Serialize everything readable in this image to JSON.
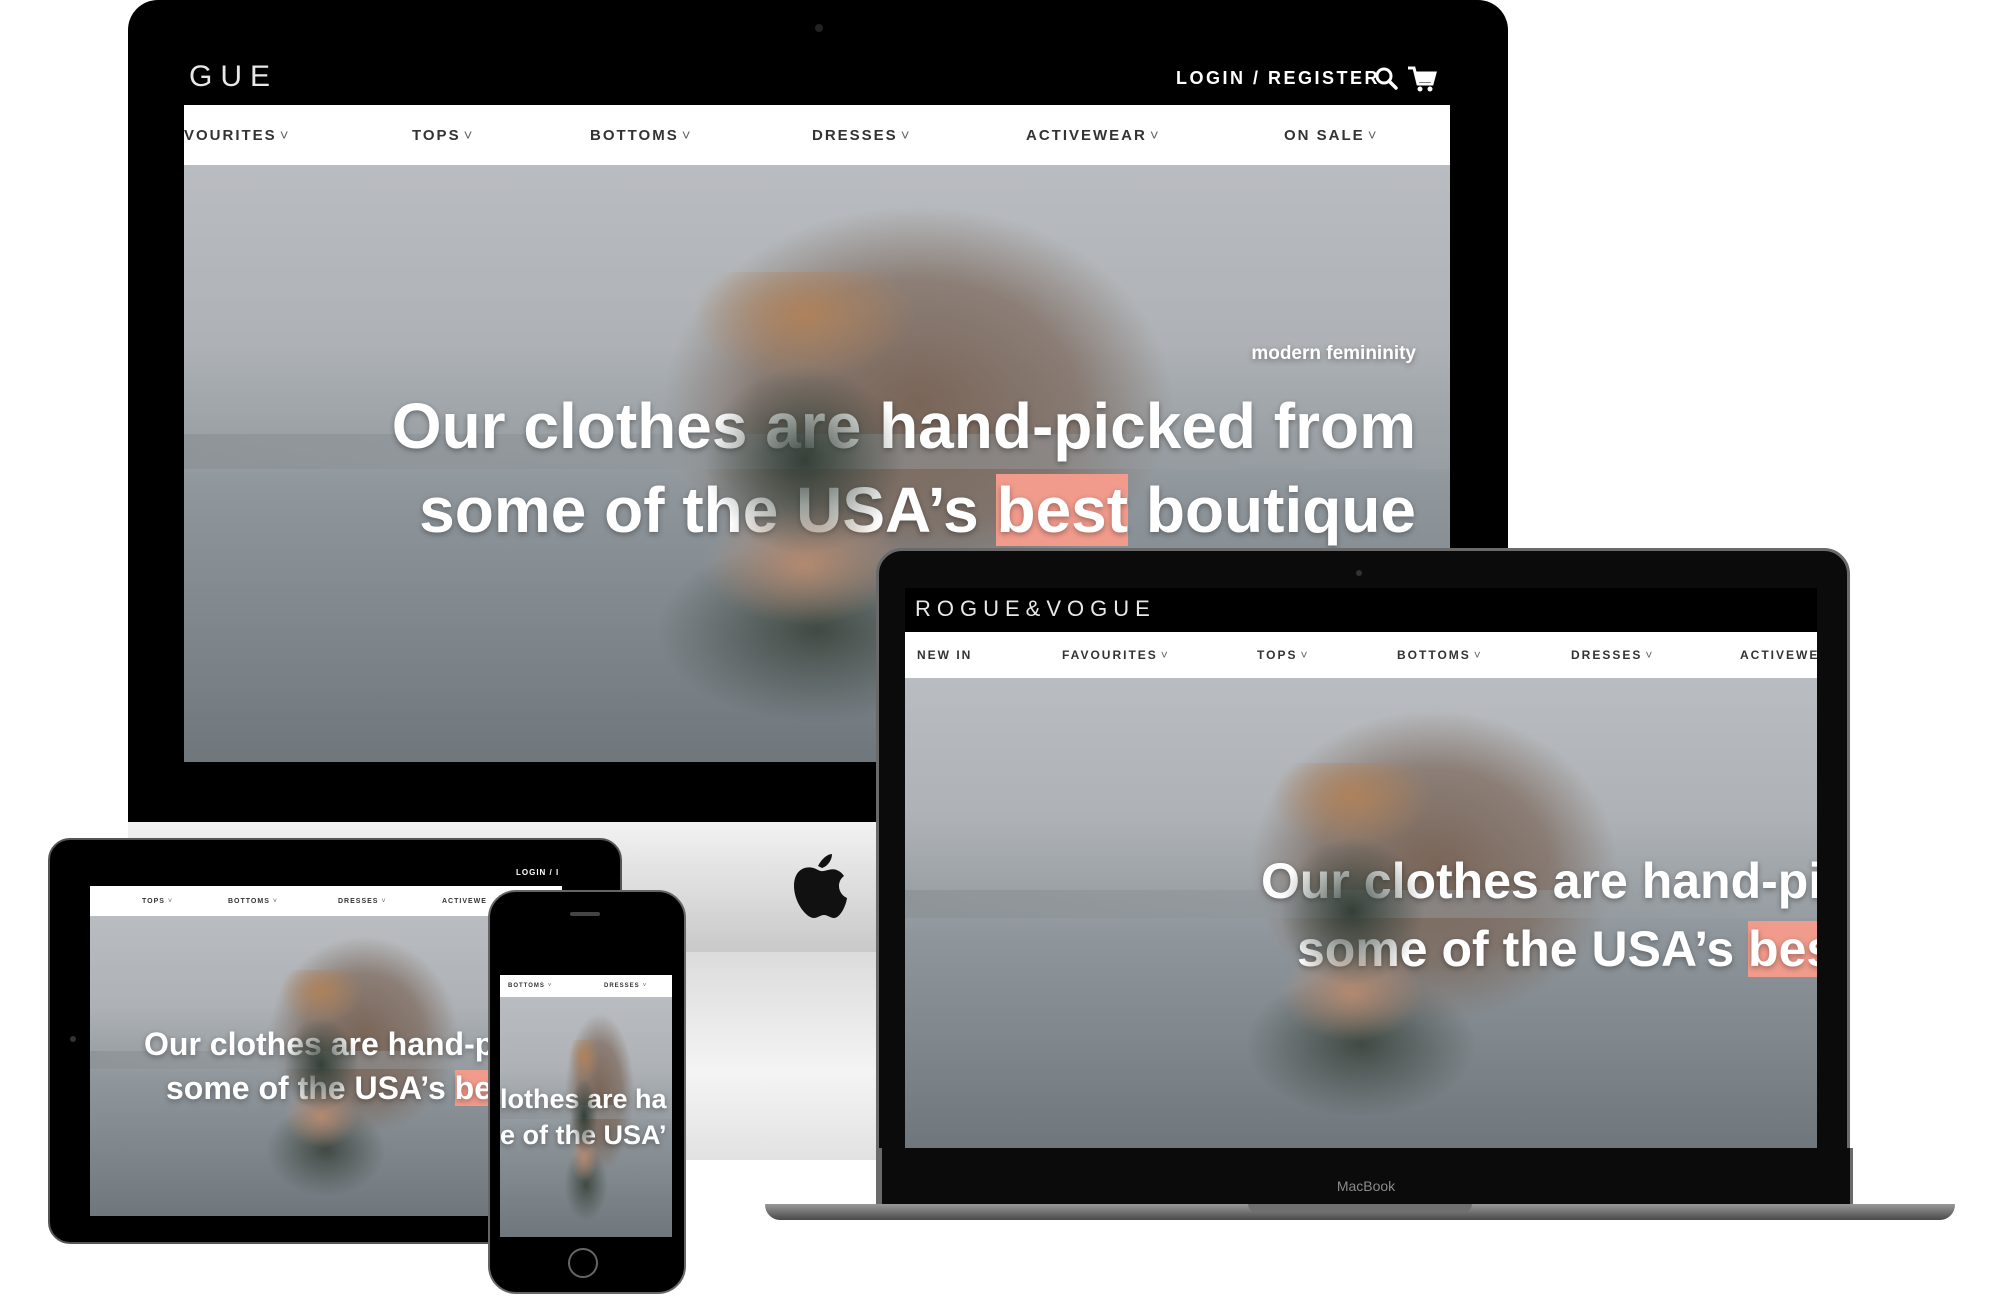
{
  "brand": {
    "full": "ROGUE&VOGUE",
    "truncated": "GUE"
  },
  "colors": {
    "accent": "#f19b8c",
    "frame": "#000000",
    "nav_bg": "#ffffff"
  },
  "desktop": {
    "login": "LOGIN / REGISTER",
    "nav": [
      "VOURITES",
      "TOPS",
      "BOTTOMS",
      "DRESSES",
      "ACTIVEWEAR",
      "ON SALE"
    ],
    "tagline": "modern femininity",
    "hero_line1": "Our clothes are hand-picked from",
    "hero_line2_pre": "some of the USA’s",
    "hero_line2_highlight": "best",
    "hero_line2_post": "boutique"
  },
  "laptop": {
    "nav": [
      "NEW IN",
      "FAVOURITES",
      "TOPS",
      "BOTTOMS",
      "DRESSES",
      "ACTIVEWE"
    ],
    "hero_line1": "Our clothes are hand-pi",
    "hero_line2_pre": "some of the USA’s",
    "hero_line2_highlight": "best",
    "label": "MacBook"
  },
  "tablet": {
    "login": "LOGIN / I",
    "nav": [
      "TOPS",
      "BOTTOMS",
      "DRESSES",
      "ACTIVEWE"
    ],
    "hero_line1": "Our clothes are hand-pi",
    "hero_line2_pre": "some of the USA’s",
    "hero_line2_highlight": "best"
  },
  "phone": {
    "nav": [
      "BOTTOMS",
      "DRESSES"
    ],
    "hero_line1": "lothes are ha",
    "hero_line2": "e of the USA’"
  },
  "icons": [
    "search-icon",
    "cart-icon",
    "apple-logo-icon",
    "chevron-down-icon",
    "home-button-icon"
  ]
}
